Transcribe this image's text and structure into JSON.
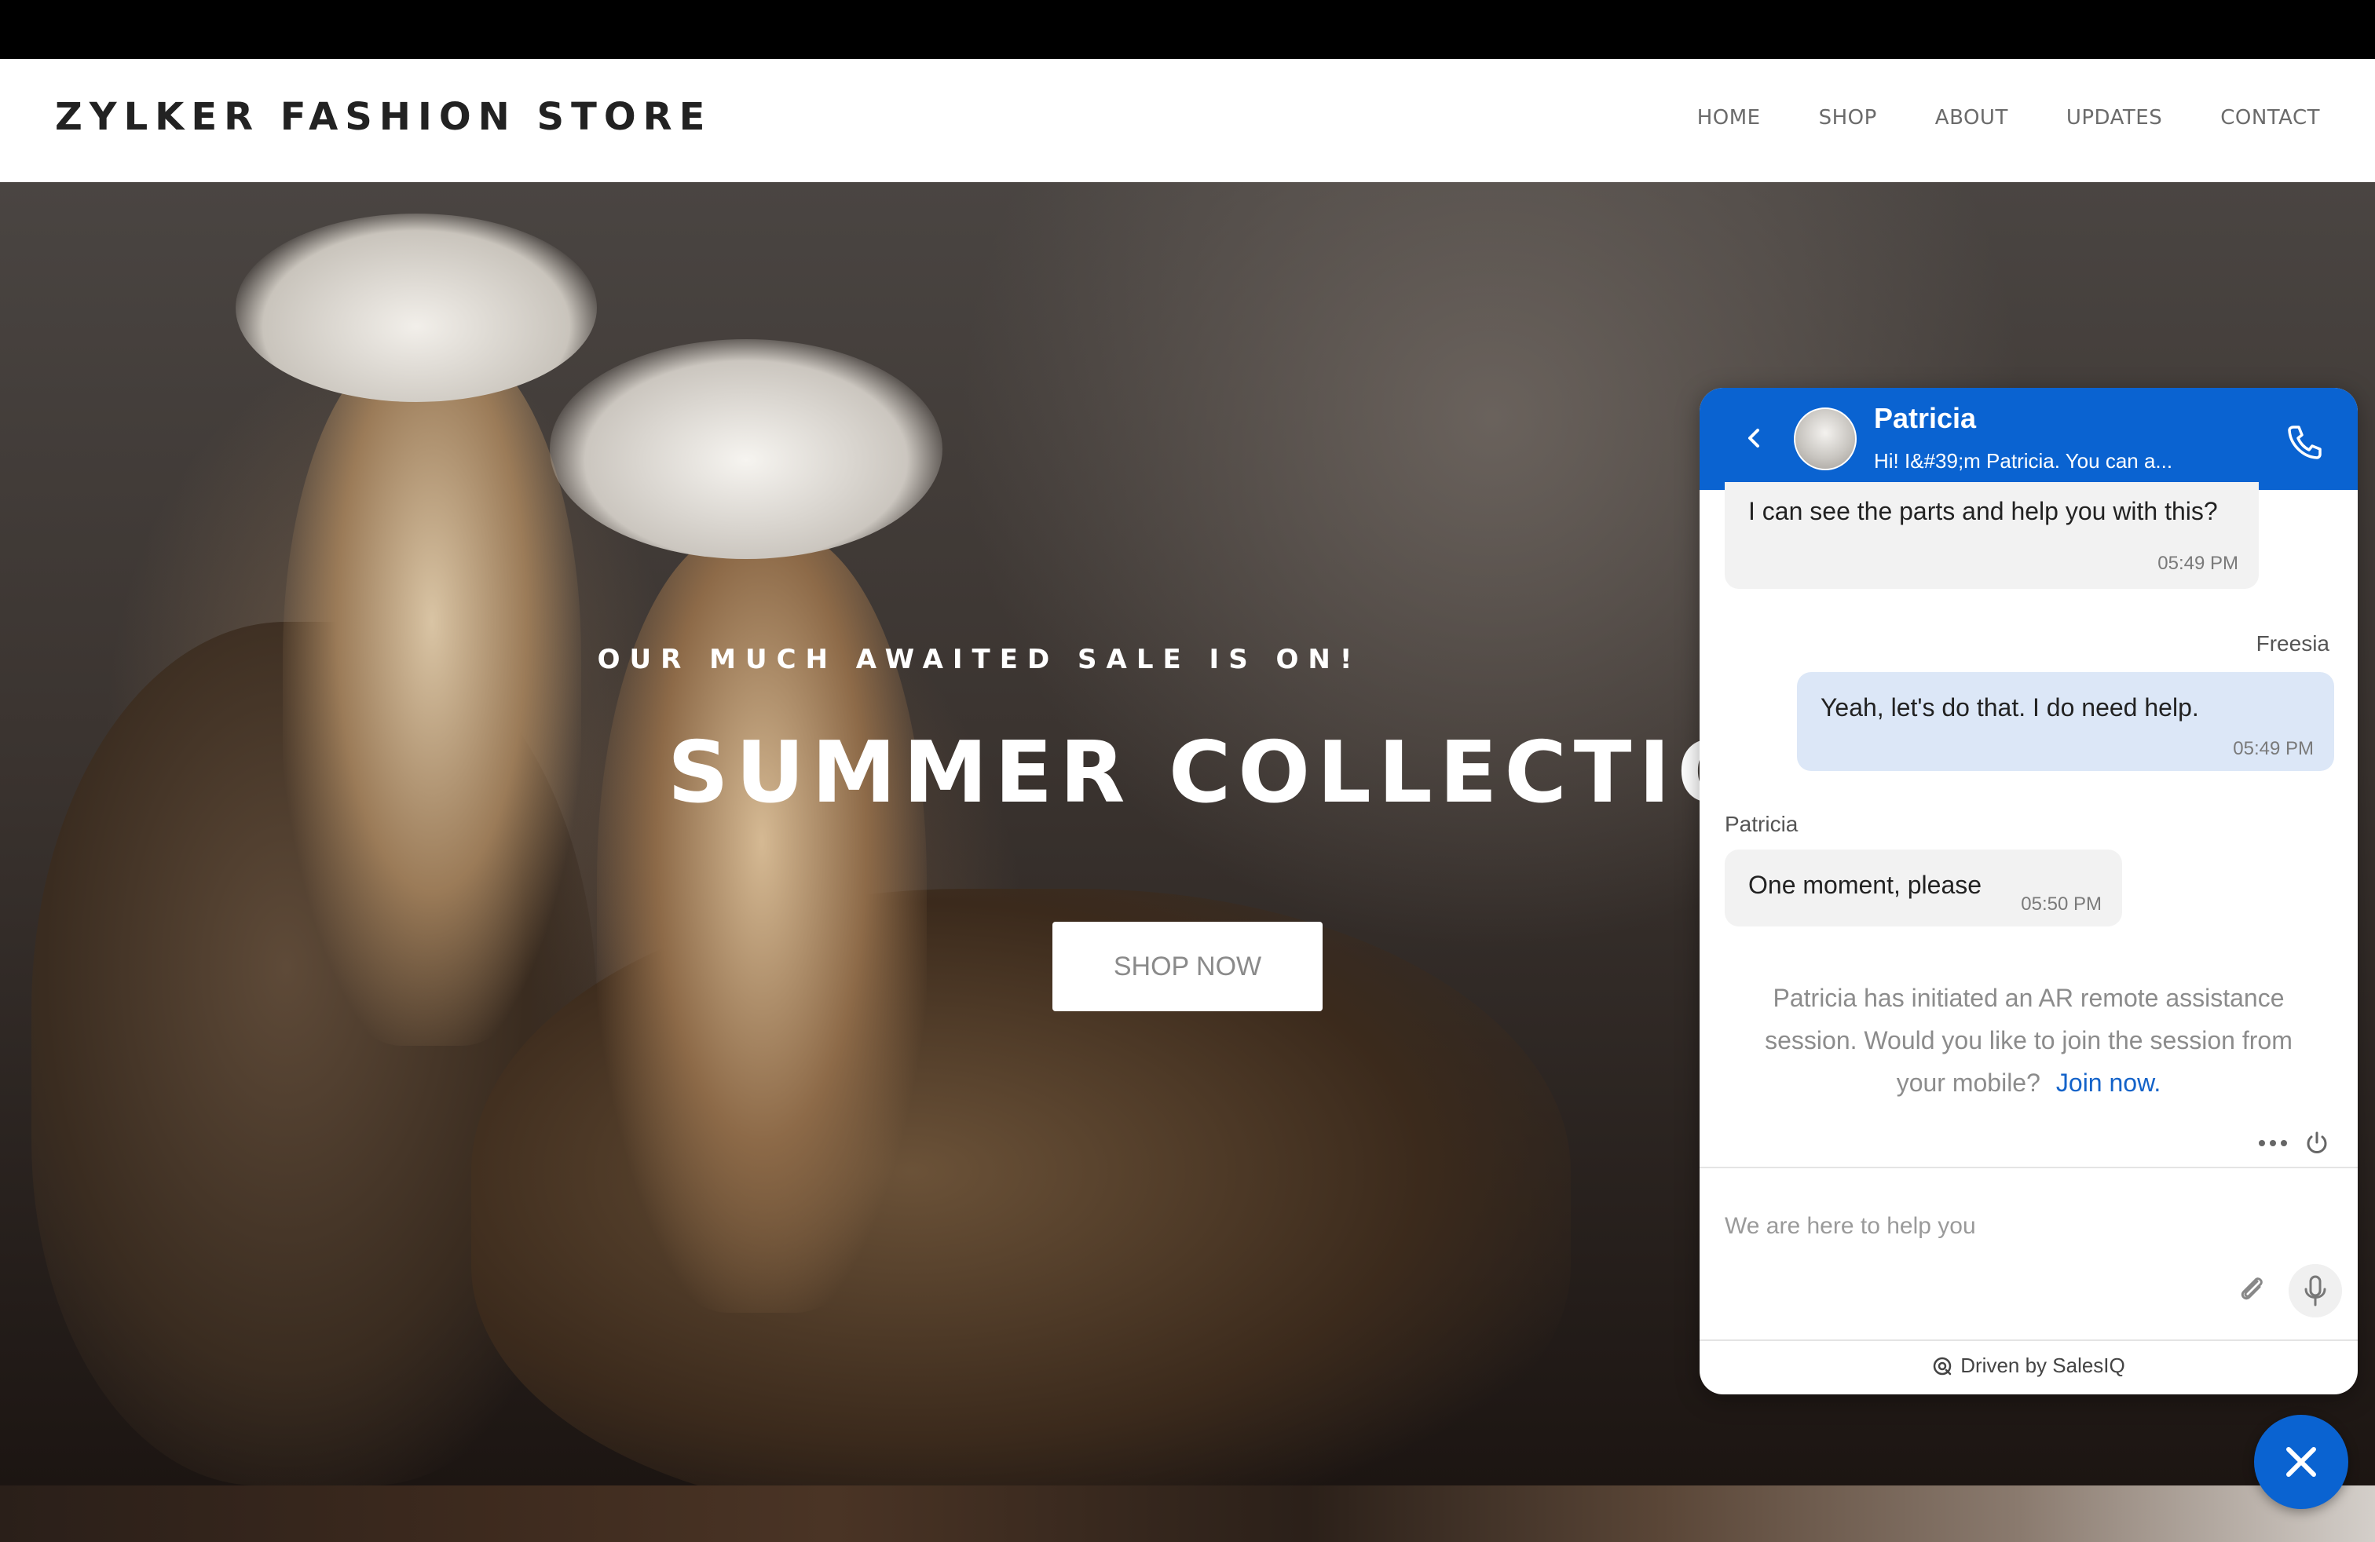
{
  "header": {
    "brand": "ZYLKER FASHION STORE",
    "nav": [
      "HOME",
      "SHOP",
      "ABOUT",
      "UPDATES",
      "CONTACT"
    ]
  },
  "hero": {
    "tagline": "OUR MUCH AWAITED SALE IS ON!",
    "title": "SUMMER COLLECTION",
    "cta_label": "SHOP NOW"
  },
  "chat": {
    "accent_color": "#0a63d1",
    "agent_name": "Patricia",
    "agent_subtitle": "Hi! I&#39;m Patricia. You can a...",
    "messages": [
      {
        "text": "I can see the parts and help you with this?",
        "time": "05:49 PM"
      },
      {
        "sender": "Freesia",
        "text": "Yeah, let's do that. I do need help.",
        "time": "05:49 PM"
      },
      {
        "sender": "Patricia",
        "text": "One moment, please",
        "time": "05:50 PM"
      }
    ],
    "system_note": "Patricia has initiated an AR remote assistance session. Would you like to join the session from your mobile?",
    "join_label": "Join now.",
    "input_placeholder": "We are here to help you",
    "powered_by": "Driven by SalesIQ"
  },
  "icons": [
    "back-arrow-icon",
    "phone-icon",
    "more-icon",
    "power-icon",
    "paperclip-icon",
    "microphone-icon",
    "salesiq-icon",
    "close-icon"
  ]
}
